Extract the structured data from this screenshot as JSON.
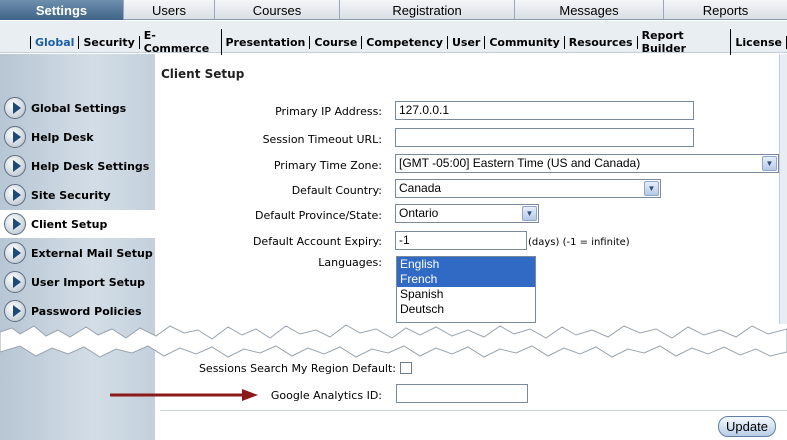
{
  "top_tabs": [
    {
      "label": "Settings"
    },
    {
      "label": "Users"
    },
    {
      "label": "Courses"
    },
    {
      "label": "Registration"
    },
    {
      "label": "Messages"
    },
    {
      "label": "Reports"
    }
  ],
  "sub_tabs": [
    {
      "label": "Global"
    },
    {
      "label": "Security"
    },
    {
      "label": "E-Commerce"
    },
    {
      "label": "Presentation"
    },
    {
      "label": "Course"
    },
    {
      "label": "Competency"
    },
    {
      "label": "User"
    },
    {
      "label": "Community"
    },
    {
      "label": "Resources"
    },
    {
      "label": "Report Builder"
    },
    {
      "label": "License"
    }
  ],
  "sidebar": {
    "items": [
      {
        "label": "Global Settings"
      },
      {
        "label": "Help Desk"
      },
      {
        "label": "Help Desk Settings"
      },
      {
        "label": "Site Security"
      },
      {
        "label": "Client Setup"
      },
      {
        "label": "External Mail Setup"
      },
      {
        "label": "User Import Setup"
      },
      {
        "label": "Password Policies"
      }
    ]
  },
  "main": {
    "title": "Client Setup",
    "fields": {
      "primary_ip": {
        "label": "Primary IP Address:",
        "value": "127.0.0.1"
      },
      "session_timeout": {
        "label": "Session Timeout URL:",
        "value": ""
      },
      "time_zone": {
        "label": "Primary Time Zone:",
        "value": "[GMT -05:00] Eastern Time (US and Canada)"
      },
      "country": {
        "label": "Default Country:",
        "value": "Canada"
      },
      "province": {
        "label": "Default Province/State:",
        "value": "Ontario"
      },
      "expiry": {
        "label": "Default Account Expiry:",
        "value": "-1",
        "hint": "(days) (-1 = infinite)"
      },
      "languages": {
        "label": "Languages:",
        "options": [
          {
            "label": "English",
            "selected": true
          },
          {
            "label": "French",
            "selected": true
          },
          {
            "label": "Spanish",
            "selected": false
          },
          {
            "label": "Deutsch",
            "selected": false
          }
        ]
      },
      "sessions_search": {
        "label": "Sessions Search My Region Default:",
        "checked": false
      },
      "google_analytics": {
        "label": "Google Analytics ID:",
        "value": ""
      }
    },
    "update_label": "Update"
  },
  "colors": {
    "active_tab": "#3f6487",
    "selection": "#316ac5",
    "arrow": "#8b1a1a"
  }
}
